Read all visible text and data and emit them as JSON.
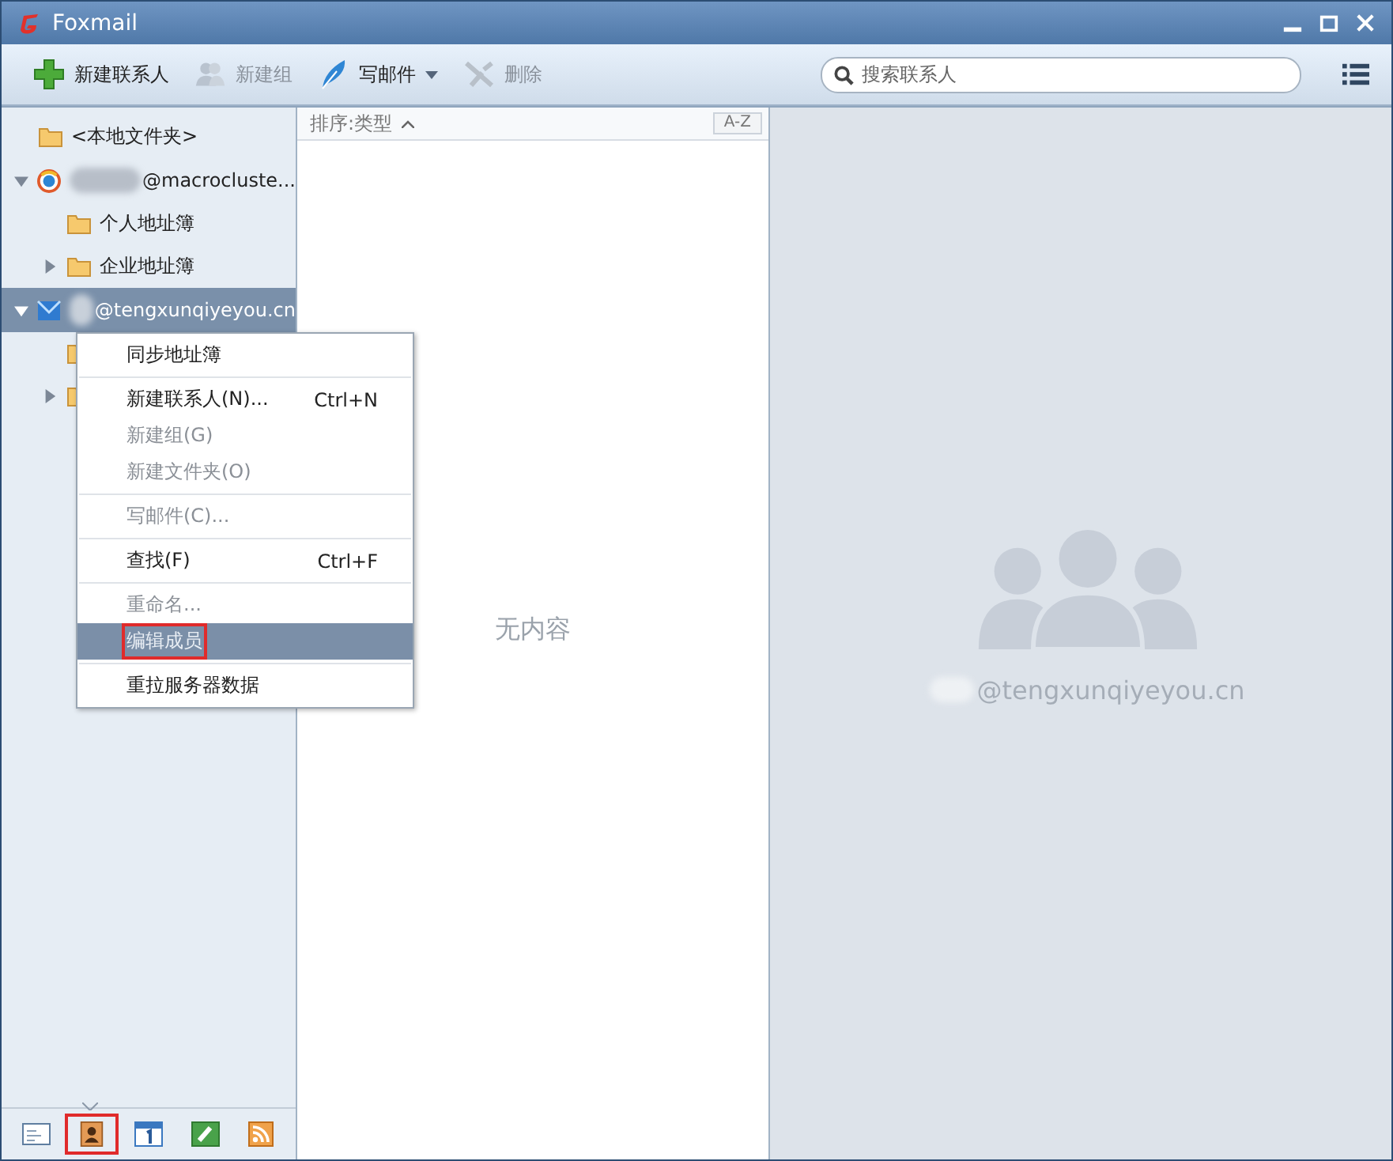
{
  "window": {
    "title": "Foxmail"
  },
  "toolbar": [
    {
      "label": "新建联系人",
      "disabled": false,
      "dropdown": false
    },
    {
      "label": "新建组",
      "disabled": true,
      "dropdown": false
    },
    {
      "label": "写邮件",
      "disabled": false,
      "dropdown": true
    },
    {
      "label": "删除",
      "disabled": true,
      "dropdown": false
    }
  ],
  "search": {
    "placeholder": "搜索联系人"
  },
  "sidebar": {
    "items": [
      {
        "label": "<本地文件夹>",
        "kind": "folder",
        "selected": false
      },
      {
        "label": "@macrocluste...",
        "kind": "account",
        "selected": false,
        "expanded": true,
        "children": [
          {
            "label": "个人地址簿",
            "kind": "folder",
            "selected": false
          },
          {
            "label": "企业地址簿",
            "kind": "folder",
            "selected": false,
            "expanded": false
          }
        ]
      },
      {
        "label": "@tengxunqiyeyou.cn",
        "kind": "account",
        "selected": true,
        "expanded": true,
        "children": [
          {
            "kind": "folder",
            "selected": false
          },
          {
            "kind": "folder",
            "selected": false,
            "expanded": false
          }
        ]
      }
    ]
  },
  "context_menu": [
    {
      "kind": "item",
      "label": "同步地址簿",
      "disabled": false,
      "selected": false
    },
    {
      "kind": "separator"
    },
    {
      "kind": "item",
      "label": "新建联系人(N)...",
      "shortcut": "Ctrl+N",
      "disabled": false,
      "selected": false
    },
    {
      "kind": "item",
      "label": "新建组(G)",
      "disabled": true,
      "selected": false
    },
    {
      "kind": "item",
      "label": "新建文件夹(O)",
      "disabled": true,
      "selected": false
    },
    {
      "kind": "separator"
    },
    {
      "kind": "item",
      "label": "写邮件(C)...",
      "disabled": true,
      "selected": false
    },
    {
      "kind": "separator"
    },
    {
      "kind": "item",
      "label": "查找(F)",
      "shortcut": "Ctrl+F",
      "disabled": false,
      "selected": false
    },
    {
      "kind": "separator"
    },
    {
      "kind": "item",
      "label": "重命名...",
      "disabled": true,
      "selected": false
    },
    {
      "kind": "item",
      "label": "编辑成员",
      "disabled": true,
      "selected": true,
      "annotated": true
    },
    {
      "kind": "separator"
    },
    {
      "kind": "item",
      "label": "重拉服务器数据",
      "disabled": false,
      "selected": false
    }
  ],
  "list": {
    "sort_label": "排序:类型",
    "sort_button": "A-Z",
    "empty_text": "无内容"
  },
  "detail": {
    "account": "@tengxunqiyeyou.cn"
  },
  "bottom_nav": [
    {
      "kind": "mail",
      "selected": false,
      "annotated": false
    },
    {
      "kind": "contacts",
      "selected": true,
      "annotated": true
    },
    {
      "kind": "calendar",
      "selected": false,
      "annotated": false
    },
    {
      "kind": "notes",
      "selected": false,
      "annotated": false
    },
    {
      "kind": "feeds",
      "selected": false,
      "annotated": false
    }
  ]
}
